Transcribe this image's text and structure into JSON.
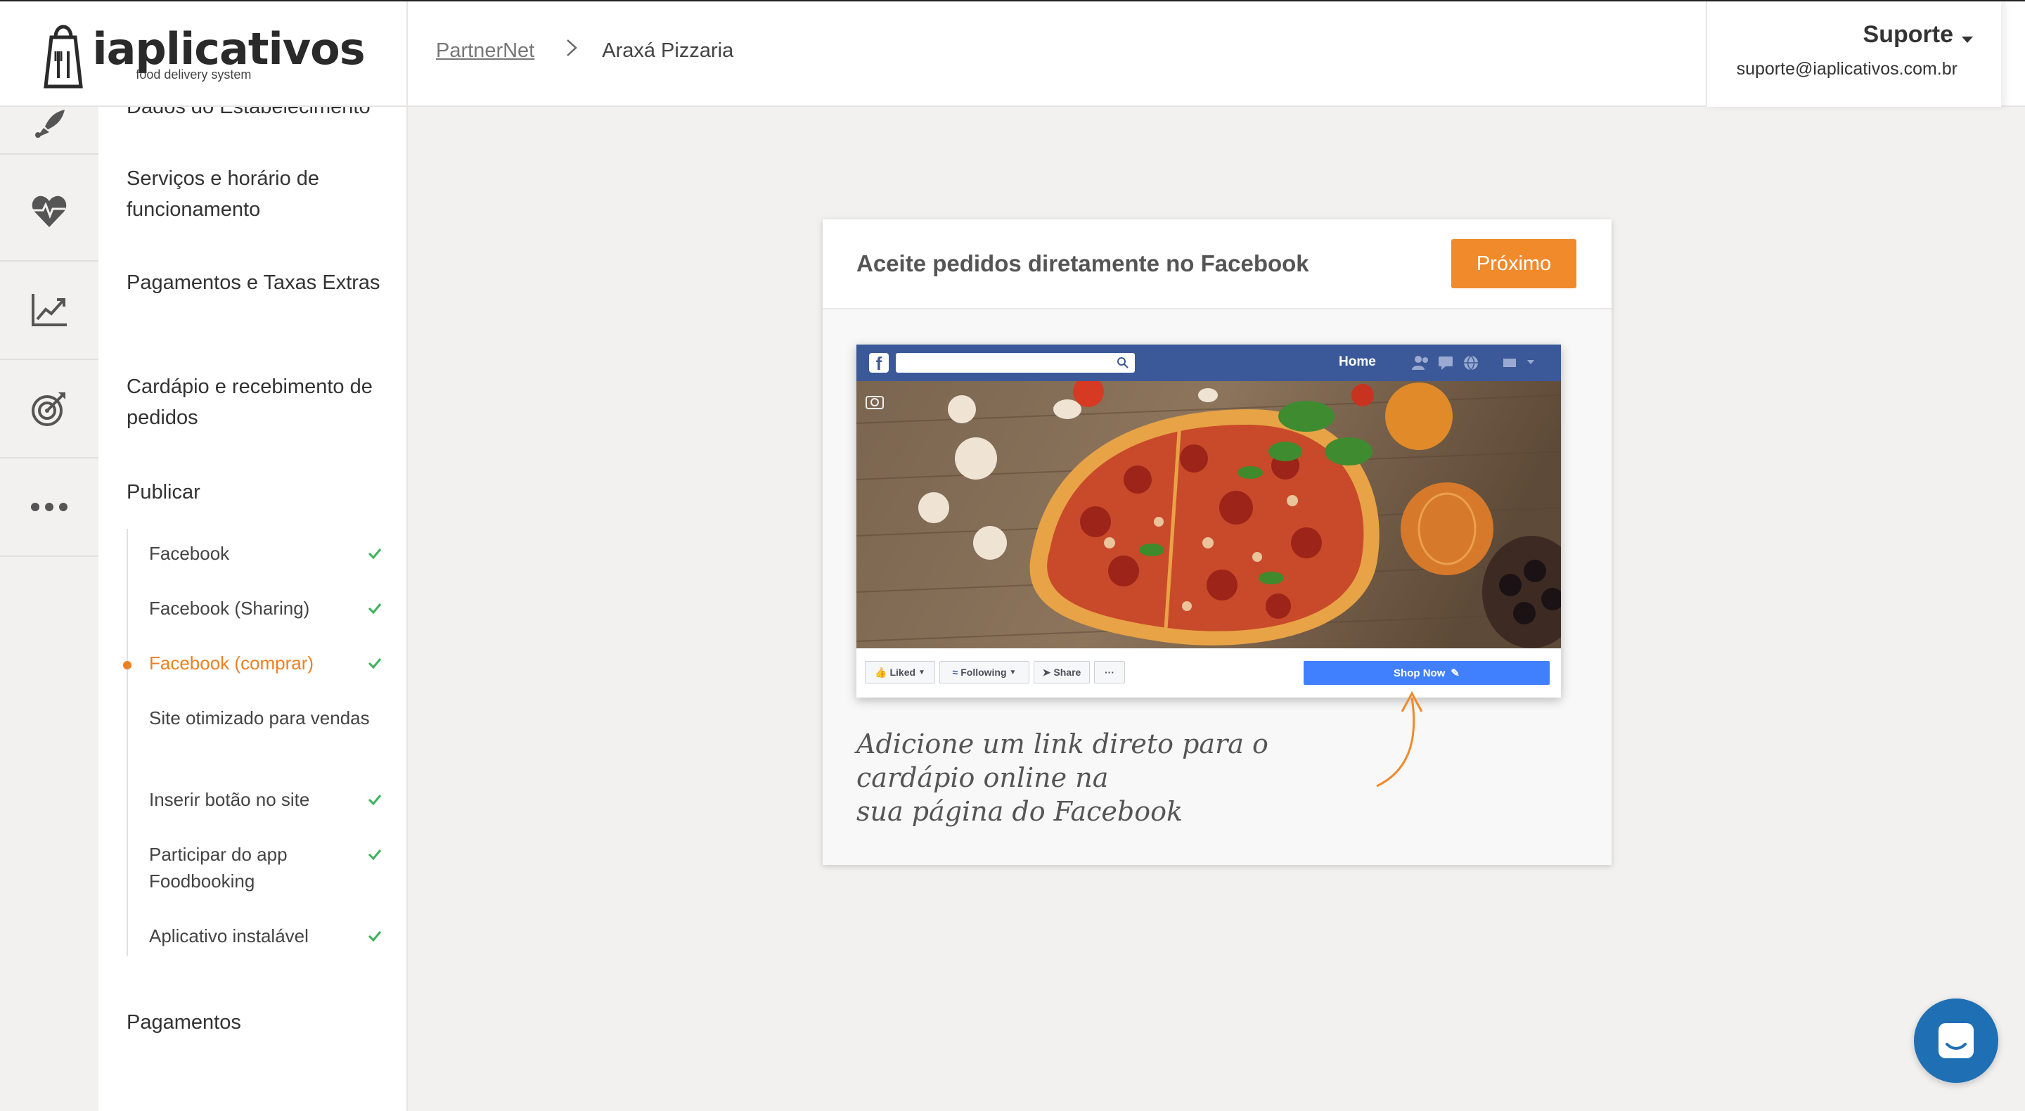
{
  "header": {
    "logo_name": "iaplicativos",
    "logo_tagline": "food delivery system",
    "breadcrumb": {
      "root": "PartnerNet",
      "current": "Araxá Pizzaria"
    },
    "user": {
      "name": "Suporte",
      "email": "suporte@iaplicativos.com.br"
    }
  },
  "rail": {
    "icons": [
      "rocket-icon",
      "heartbeat-icon",
      "chart-line-icon",
      "target-icon",
      "more-icon"
    ]
  },
  "sidebar": {
    "items": [
      {
        "label": "Dados do Estabelecimento"
      },
      {
        "label": "Serviços e horário de funcionamento"
      },
      {
        "label": "Pagamentos e Taxas Extras"
      },
      {
        "label": "Cardápio e recebimento de pedidos"
      },
      {
        "label": "Publicar"
      },
      {
        "label": "Pagamentos"
      }
    ],
    "publish_subitems": [
      {
        "label": "Facebook",
        "done": true
      },
      {
        "label": "Facebook (Sharing)",
        "done": true
      },
      {
        "label": "Facebook (comprar)",
        "done": true,
        "active": true
      },
      {
        "label": "Site otimizado para vendas",
        "done": false
      },
      {
        "label": "Inserir botão no site",
        "done": true
      },
      {
        "label": "Participar do app Foodbooking",
        "done": true
      },
      {
        "label": "Aplicativo instalável",
        "done": true
      }
    ]
  },
  "card": {
    "title": "Aceite pedidos diretamente no Facebook",
    "next_label": "Próximo",
    "mock": {
      "home_label": "Home",
      "liked_label": "Liked",
      "following_label": "Following",
      "share_label": "Share",
      "more_label": "···",
      "shop_now_label": "Shop Now"
    },
    "caption_lines": [
      "Adicione um link direto para o",
      "cardápio online na",
      "sua página do Facebook"
    ]
  },
  "colors": {
    "accent": "#f08a2b",
    "check": "#3cb45a",
    "facebook": "#3b5998",
    "chat": "#1f6fb5"
  }
}
